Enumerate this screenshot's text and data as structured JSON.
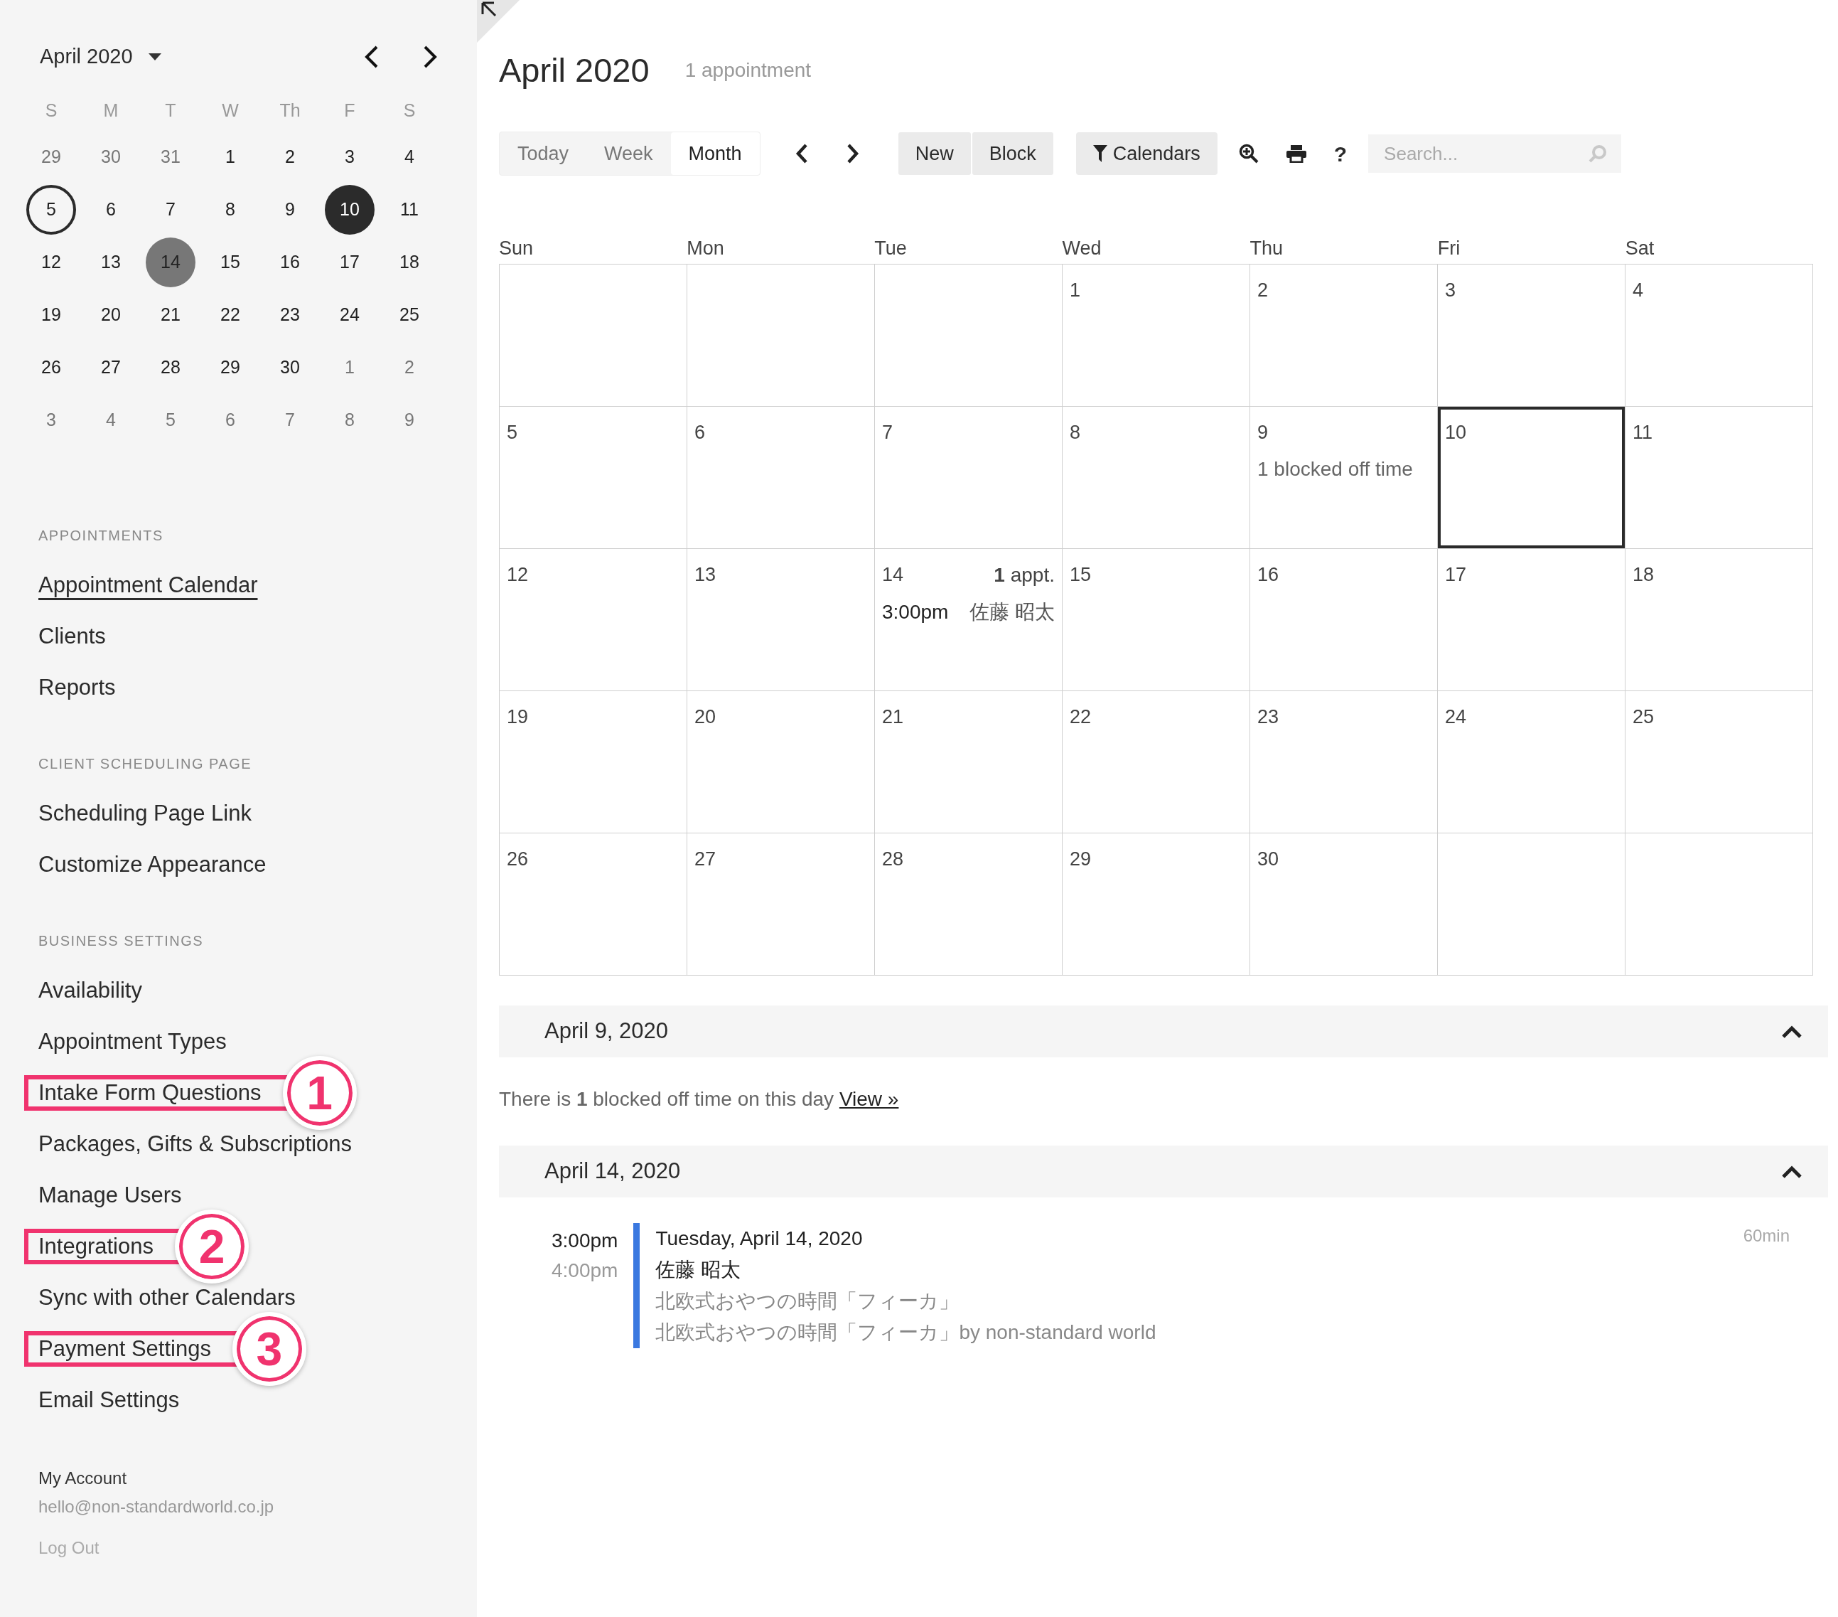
{
  "mini_calendar": {
    "title": "April 2020",
    "weekdays": [
      "S",
      "M",
      "T",
      "W",
      "Th",
      "F",
      "S"
    ],
    "days": [
      {
        "day": "29",
        "kind": "other",
        "selected": false
      },
      {
        "day": "30",
        "kind": "other",
        "selected": false
      },
      {
        "day": "31",
        "kind": "other",
        "selected": false
      },
      {
        "day": "1",
        "kind": "normal",
        "selected": false
      },
      {
        "day": "2",
        "kind": "normal",
        "selected": false
      },
      {
        "day": "3",
        "kind": "normal",
        "selected": false
      },
      {
        "day": "4",
        "kind": "normal",
        "selected": false
      },
      {
        "day": "5",
        "kind": "outlined",
        "selected": false
      },
      {
        "day": "6",
        "kind": "normal",
        "selected": false
      },
      {
        "day": "7",
        "kind": "normal",
        "selected": false
      },
      {
        "day": "8",
        "kind": "normal",
        "selected": false
      },
      {
        "day": "9",
        "kind": "normal",
        "selected": false
      },
      {
        "day": "10",
        "kind": "normal",
        "selected": true
      },
      {
        "day": "11",
        "kind": "normal",
        "selected": false
      },
      {
        "day": "12",
        "kind": "normal",
        "selected": false
      },
      {
        "day": "13",
        "kind": "normal",
        "selected": false
      },
      {
        "day": "14",
        "kind": "busy",
        "selected": false
      },
      {
        "day": "15",
        "kind": "normal",
        "selected": false
      },
      {
        "day": "16",
        "kind": "normal",
        "selected": false
      },
      {
        "day": "17",
        "kind": "normal",
        "selected": false
      },
      {
        "day": "18",
        "kind": "normal",
        "selected": false
      },
      {
        "day": "19",
        "kind": "normal",
        "selected": false
      },
      {
        "day": "20",
        "kind": "normal",
        "selected": false
      },
      {
        "day": "21",
        "kind": "normal",
        "selected": false
      },
      {
        "day": "22",
        "kind": "normal",
        "selected": false
      },
      {
        "day": "23",
        "kind": "normal",
        "selected": false
      },
      {
        "day": "24",
        "kind": "normal",
        "selected": false
      },
      {
        "day": "25",
        "kind": "normal",
        "selected": false
      },
      {
        "day": "26",
        "kind": "normal",
        "selected": false
      },
      {
        "day": "27",
        "kind": "normal",
        "selected": false
      },
      {
        "day": "28",
        "kind": "normal",
        "selected": false
      },
      {
        "day": "29",
        "kind": "normal",
        "selected": false
      },
      {
        "day": "30",
        "kind": "normal",
        "selected": false
      },
      {
        "day": "1",
        "kind": "other",
        "selected": false
      },
      {
        "day": "2",
        "kind": "other",
        "selected": false
      },
      {
        "day": "3",
        "kind": "other",
        "selected": false
      },
      {
        "day": "4",
        "kind": "other",
        "selected": false
      },
      {
        "day": "5",
        "kind": "other",
        "selected": false
      },
      {
        "day": "6",
        "kind": "other",
        "selected": false
      },
      {
        "day": "7",
        "kind": "other",
        "selected": false
      },
      {
        "day": "8",
        "kind": "other",
        "selected": false
      },
      {
        "day": "9",
        "kind": "other",
        "selected": false
      }
    ]
  },
  "sidebar": {
    "sections": [
      {
        "heading": "APPOINTMENTS",
        "items": [
          {
            "label": "Appointment Calendar",
            "selected": true,
            "highlighted": false
          },
          {
            "label": "Clients",
            "selected": false,
            "highlighted": false
          },
          {
            "label": "Reports",
            "selected": false,
            "highlighted": false
          }
        ]
      },
      {
        "heading": "CLIENT SCHEDULING PAGE",
        "items": [
          {
            "label": "Scheduling Page Link",
            "selected": false,
            "highlighted": false
          },
          {
            "label": "Customize Appearance",
            "selected": false,
            "highlighted": false
          }
        ]
      },
      {
        "heading": "BUSINESS SETTINGS",
        "items": [
          {
            "label": "Availability",
            "selected": false,
            "highlighted": false
          },
          {
            "label": "Appointment Types",
            "selected": false,
            "highlighted": false
          },
          {
            "label": "Intake Form Questions",
            "selected": false,
            "highlighted": true,
            "badge": "1"
          },
          {
            "label": "Packages, Gifts & Subscriptions",
            "selected": false,
            "highlighted": false
          },
          {
            "label": "Manage Users",
            "selected": false,
            "highlighted": false
          },
          {
            "label": "Integrations",
            "selected": false,
            "highlighted": true,
            "badge": "2"
          },
          {
            "label": "Sync with other Calendars",
            "selected": false,
            "highlighted": false
          },
          {
            "label": "Payment Settings",
            "selected": false,
            "highlighted": true,
            "badge": "3"
          },
          {
            "label": "Email Settings",
            "selected": false,
            "highlighted": false
          }
        ]
      }
    ],
    "account": {
      "label": "My Account",
      "email": "hello@non-standardworld.co.jp",
      "logout": "Log Out"
    }
  },
  "header": {
    "title": "April 2020",
    "count": "1 appointment"
  },
  "toolbar": {
    "views": [
      {
        "label": "Today",
        "selected": false
      },
      {
        "label": "Week",
        "selected": false
      },
      {
        "label": "Month",
        "selected": true
      }
    ],
    "actions": [
      "New",
      "Block"
    ],
    "calendars": "Calendars",
    "help": "?",
    "search": {
      "placeholder": "Search..."
    }
  },
  "month_grid": {
    "weekdays": [
      "Sun",
      "Mon",
      "Tue",
      "Wed",
      "Thu",
      "Fri",
      "Sat"
    ],
    "cells": [
      {
        "selected": false
      },
      {
        "selected": false
      },
      {
        "selected": false
      },
      {
        "day": "1",
        "selected": false
      },
      {
        "day": "2",
        "selected": false
      },
      {
        "day": "3",
        "selected": false
      },
      {
        "day": "4",
        "selected": false
      },
      {
        "day": "5",
        "selected": false
      },
      {
        "day": "6",
        "selected": false
      },
      {
        "day": "7",
        "selected": false
      },
      {
        "day": "8",
        "selected": false
      },
      {
        "day": "9",
        "selected": false,
        "note": "1 blocked off time"
      },
      {
        "day": "10",
        "selected": true
      },
      {
        "day": "11",
        "selected": false
      },
      {
        "day": "12",
        "selected": false
      },
      {
        "day": "13",
        "selected": false
      },
      {
        "day": "14",
        "selected": false,
        "count": "**1** appt.",
        "events": [
          {
            "time": "3:00pm",
            "name": "佐藤 昭太"
          }
        ]
      },
      {
        "day": "15",
        "selected": false
      },
      {
        "day": "16",
        "selected": false
      },
      {
        "day": "17",
        "selected": false
      },
      {
        "day": "18",
        "selected": false
      },
      {
        "day": "19",
        "selected": false
      },
      {
        "day": "20",
        "selected": false
      },
      {
        "day": "21",
        "selected": false
      },
      {
        "day": "22",
        "selected": false
      },
      {
        "day": "23",
        "selected": false
      },
      {
        "day": "24",
        "selected": false
      },
      {
        "day": "25",
        "selected": false
      },
      {
        "day": "26",
        "selected": false
      },
      {
        "day": "27",
        "selected": false
      },
      {
        "day": "28",
        "selected": false
      },
      {
        "day": "29",
        "selected": false
      },
      {
        "day": "30",
        "selected": false
      },
      {
        "selected": false
      },
      {
        "selected": false
      }
    ]
  },
  "day_sections": [
    {
      "heading": "April 9, 2020",
      "expanded": true,
      "kind": "note",
      "text": "There is **1** blocked off time on this day",
      "link": "View »"
    },
    {
      "heading": "April 14, 2020",
      "expanded": true,
      "kind": "appointment",
      "start": "3:00pm",
      "end": "4:00pm",
      "date": "Tuesday, April 14, 2020",
      "client": "佐藤 昭太",
      "type": "北欧式おやつの時間「フィーカ」",
      "calendar": "北欧式おやつの時間「フィーカ」by non-standard world",
      "duration": "60min",
      "color": "#3a78e0"
    }
  ]
}
